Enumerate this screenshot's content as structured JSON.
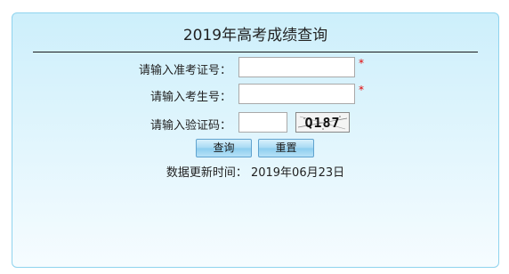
{
  "form": {
    "title": "2019年高考成绩查询",
    "fields": [
      {
        "label": "请输入准考证号：",
        "value": "",
        "required_mark": "*"
      },
      {
        "label": "请输入考生号：",
        "value": "",
        "required_mark": "*"
      },
      {
        "label": "请输入验证码：",
        "value": ""
      }
    ],
    "captcha_text": "Q187",
    "buttons": {
      "query_label": "查询",
      "reset_label": "重置"
    },
    "update_text": "数据更新时间： 2019年06月23日"
  },
  "colors": {
    "panel_border": "#8fd3ee",
    "panel_top": "#cdeffb",
    "required": "#e30000",
    "button_top": "#d8f0fc",
    "button_bottom": "#8ccdef"
  }
}
